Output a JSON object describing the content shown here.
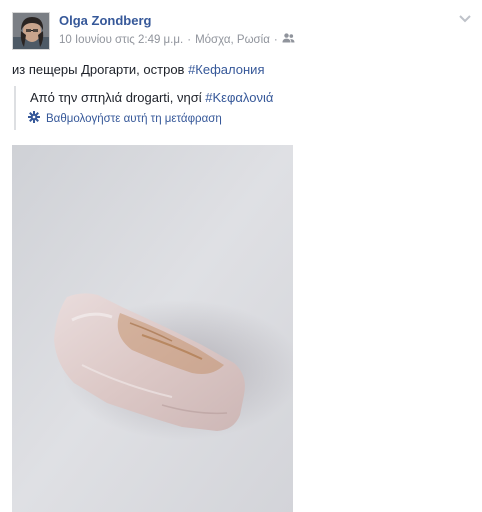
{
  "post": {
    "author": "Olga Zondberg",
    "timestamp": "10 Ιουνίου στις 2:49 μ.μ.",
    "separator": "·",
    "location": "Μόσχα, Ρωσία",
    "audience_icon": "friends-icon",
    "menu_icon": "chevron-down-icon",
    "text_prefix": "из пещеры Дрогарти, остров ",
    "text_hashtag": "#Кефалония",
    "translation": {
      "text_prefix": "Από την σπηλιά drogarti, νησί ",
      "text_hashtag": "#Κεφαλονιά",
      "rate_label": "Βαθμολογήστε αυτή τη μετάφραση",
      "rate_icon": "gear-icon"
    },
    "photo_subject": "crystal-rock-photo"
  },
  "colors": {
    "link": "#365899",
    "text": "#1d2129",
    "muted": "#90949c"
  }
}
